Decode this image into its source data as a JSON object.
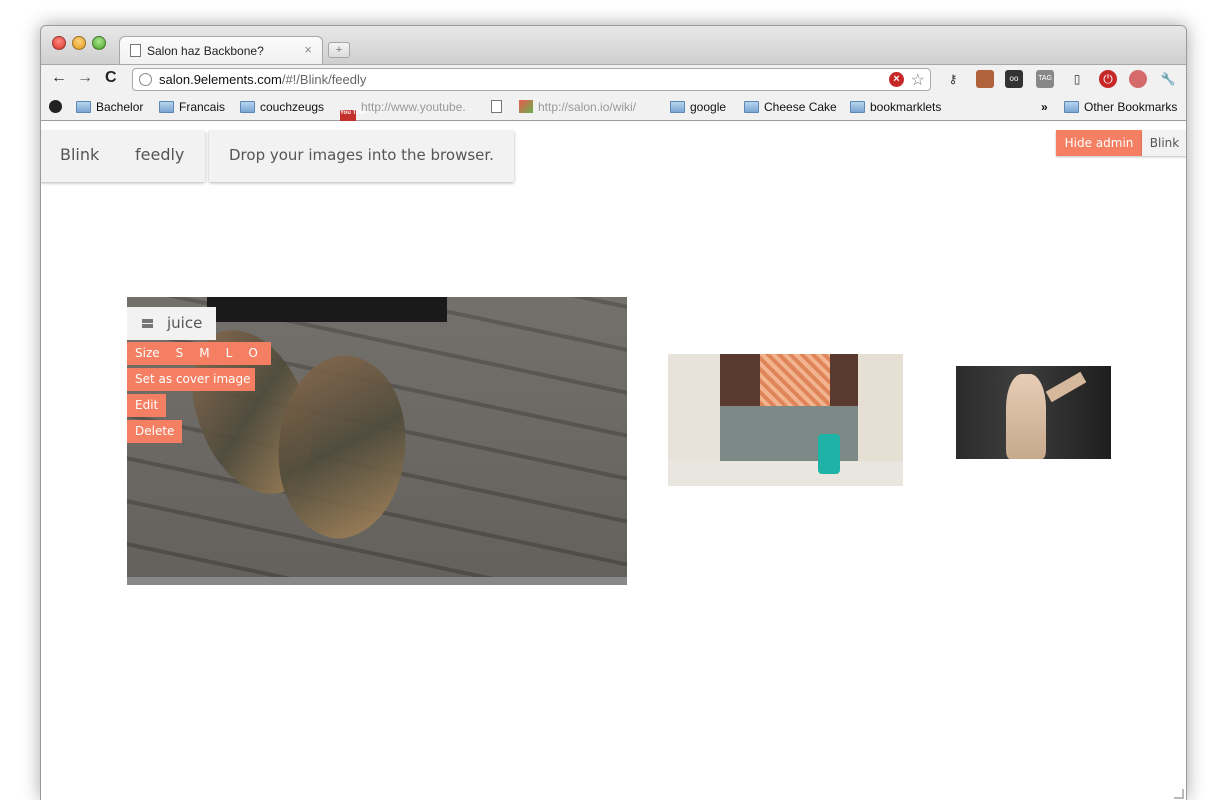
{
  "browser": {
    "tab_title": "Salon haz Backbone?",
    "tab_close": "×",
    "new_tab": "+",
    "url_host": "salon.9elements.com",
    "url_path": "/#!/Blink/feedly",
    "nav": {
      "back": "←",
      "forward": "→",
      "reload": "C"
    },
    "bookmarks": [
      {
        "label": "Bachelor",
        "icon": "folder-icon"
      },
      {
        "label": "Francais",
        "icon": "folder-icon"
      },
      {
        "label": "couchzeugs",
        "icon": "folder-icon"
      },
      {
        "label": "http://www.youtube.",
        "icon": "youtube-icon"
      },
      {
        "label": "",
        "icon": "page-icon"
      },
      {
        "label": "http://salon.io/wiki/",
        "icon": "feather-icon"
      },
      {
        "label": "google",
        "icon": "folder-icon"
      },
      {
        "label": "Cheese Cake",
        "icon": "folder-icon"
      },
      {
        "label": "bookmarklets",
        "icon": "folder-icon"
      }
    ],
    "bookmarks_overflow": "»",
    "other_bookmarks": "Other Bookmarks"
  },
  "header": {
    "crumb_user": "Blink",
    "crumb_page": "feedly",
    "drop_hint": "Drop your images into the browser.",
    "admin_toggle": "Hide admin",
    "user_link": "Blink"
  },
  "main_photo": {
    "label": "juice",
    "size_label": "Size",
    "sizes": [
      "S",
      "M",
      "L",
      "O"
    ],
    "set_cover": "Set as cover image",
    "edit": "Edit",
    "delete": "Delete"
  },
  "colors": {
    "accent": "#f47f62",
    "panel": "#f2f2f2"
  }
}
